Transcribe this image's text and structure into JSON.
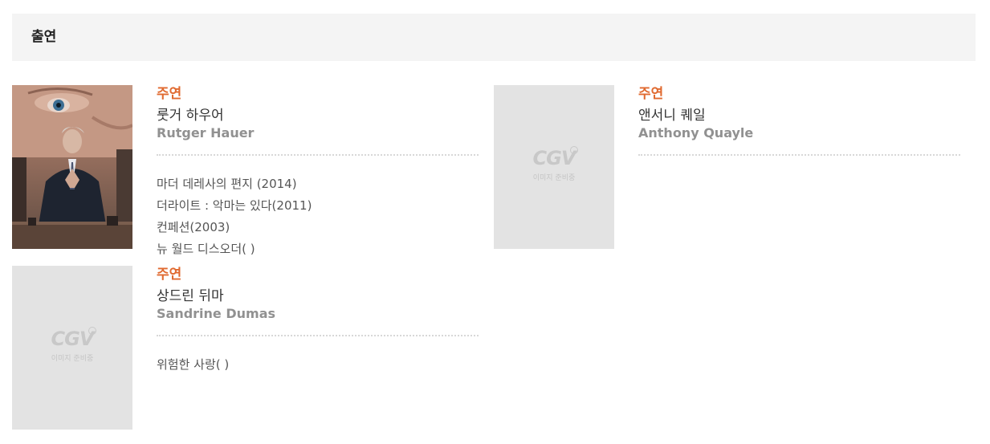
{
  "section": {
    "title": "출연"
  },
  "placeholder": {
    "logo": "CGV",
    "caption": "이미지 준비중"
  },
  "cast": [
    {
      "role": "주연",
      "name_ko": "룻거 하우어",
      "name_en": "Rutger Hauer",
      "films": [
        "마더 데레사의 편지 (2014)",
        "더라이트 : 악마는 있다(2011)",
        "컨페션(2003)",
        "뉴 월드 디스오더( )"
      ]
    },
    {
      "role": "주연",
      "name_ko": "앤서니 퀘일",
      "name_en": "Anthony Quayle",
      "films": []
    },
    {
      "role": "주연",
      "name_ko": "상드린 뒤마",
      "name_en": "Sandrine Dumas",
      "films": [
        "위험한 사랑( )"
      ]
    }
  ]
}
